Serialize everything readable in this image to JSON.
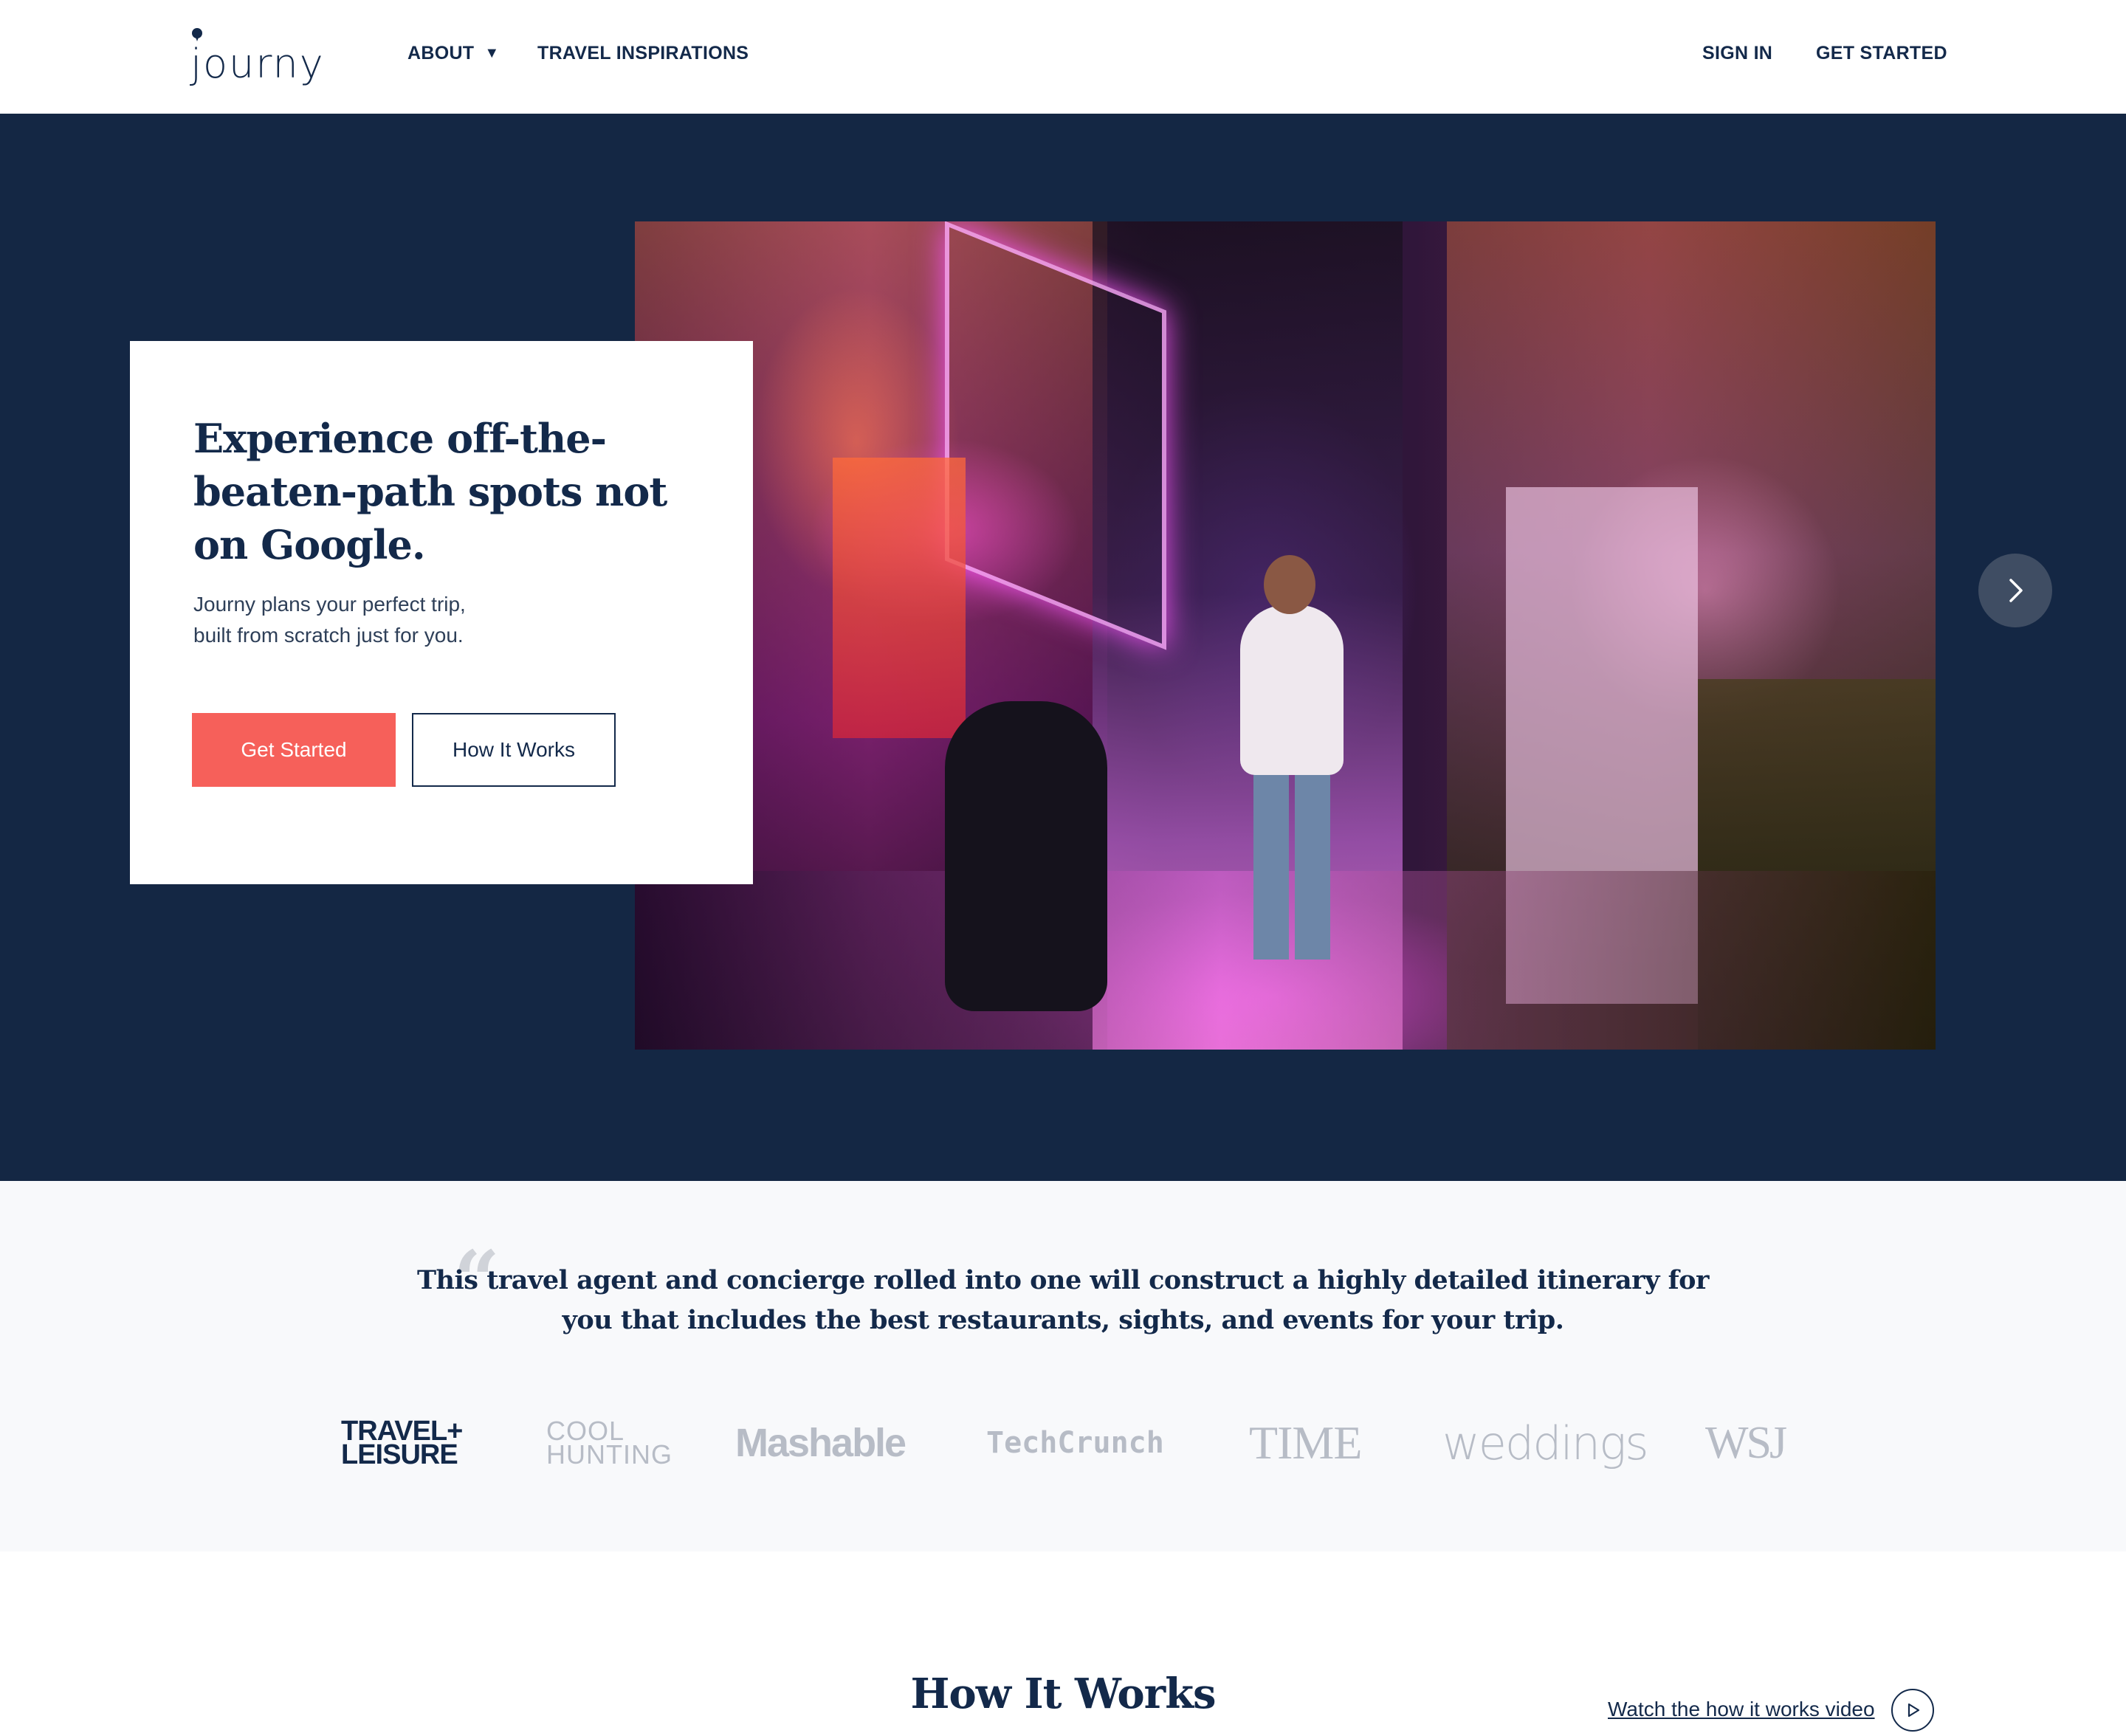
{
  "brand": {
    "logo_text": "journy"
  },
  "header": {
    "nav_about": "ABOUT",
    "nav_about_caret": "▼",
    "nav_travel": "TRAVEL INSPIRATIONS",
    "sign_in": "SIGN IN",
    "get_started": "GET STARTED"
  },
  "hero": {
    "title": "Experience off-the-beaten-path spots not on Google.",
    "subtitle_line1": "Journy plans your perfect trip,",
    "subtitle_line2": "built from scratch just for you.",
    "primary_button": "Get Started",
    "secondary_button": "How It Works"
  },
  "press": {
    "quote_mark": "“",
    "quote": "This travel agent and concierge rolled into one will construct a highly detailed itinerary for you that includes the best restaurants, sights, and events for your trip.",
    "logos": {
      "travel_line1": "TRAVEL+",
      "travel_line2": "LEISURE",
      "cool_line1": "COOL",
      "cool_line2": "HUNTING",
      "mashable": "Mashable",
      "techcrunch": "TechCrunch",
      "time": "TIME",
      "weddings": "weddings",
      "wsj": "WSJ"
    }
  },
  "how_it_works": {
    "title": "How It Works",
    "watch_link": "Watch the how it works video"
  },
  "colors": {
    "navy": "#13294a",
    "hero_bg": "#142744",
    "accent": "#f6605a",
    "press_bg": "#f8f9fb",
    "logo_gray": "#b7bcc6"
  },
  "icons": [
    "location-pin-icon",
    "caret-down-icon",
    "chevron-right-icon",
    "play-icon",
    "quote-icon"
  ]
}
